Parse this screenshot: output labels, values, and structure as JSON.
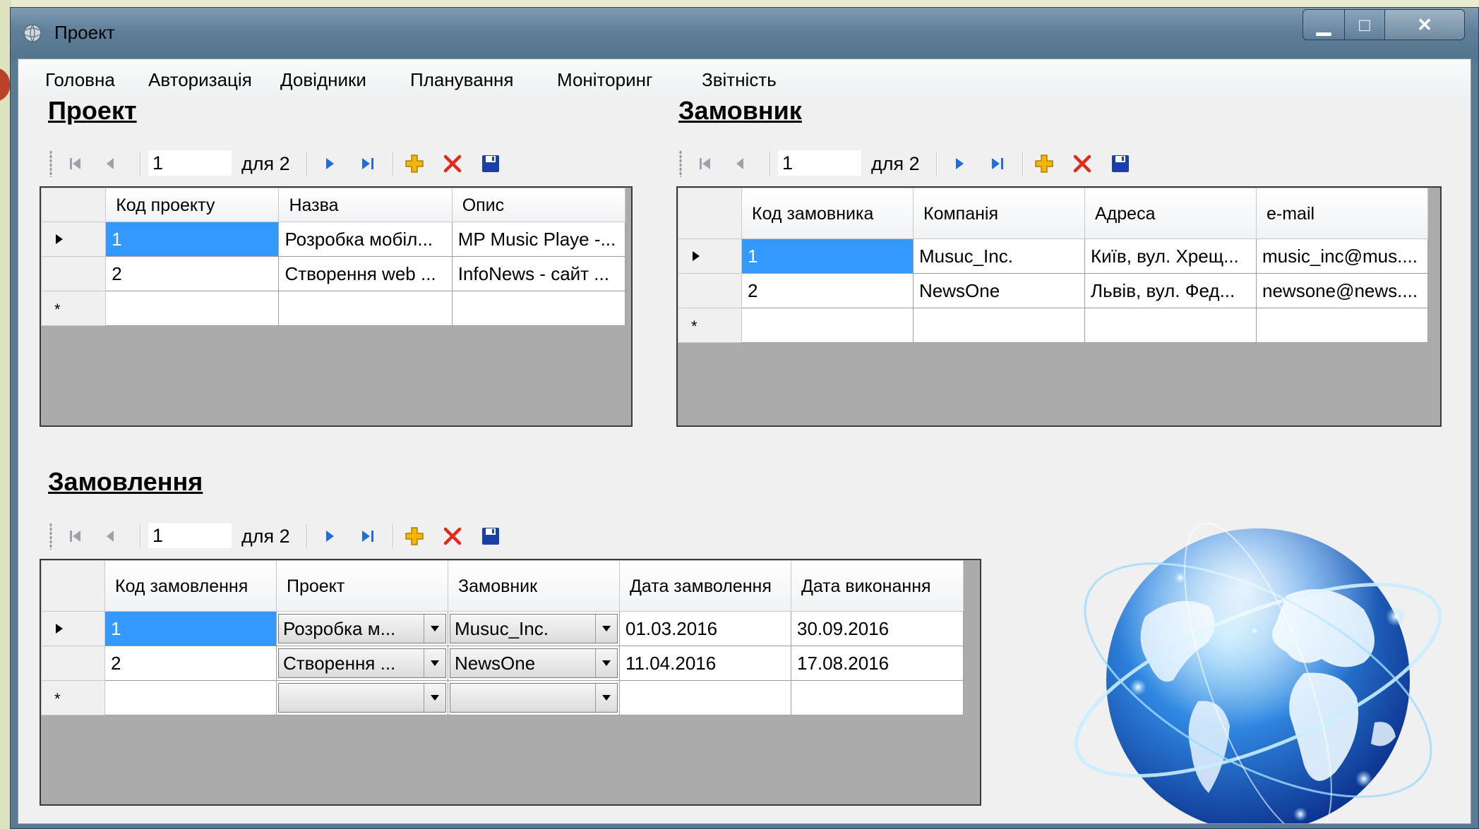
{
  "window": {
    "title": "Проект",
    "controls": {
      "minimize": "▁",
      "maximize": "□",
      "close": "✕"
    }
  },
  "menu": [
    "Головна",
    "Авторизація",
    "Довідники",
    "Планування",
    "Моніторинг",
    "Звітність"
  ],
  "navigator": {
    "position": "1",
    "count_label": "для 2"
  },
  "sections": {
    "project": {
      "title": "Проект",
      "columns": [
        "Код проекту",
        "Назва",
        "Опис"
      ],
      "rows": [
        [
          "1",
          "Розробка мобіл...",
          "MP Music Playe -..."
        ],
        [
          "2",
          "Створення web ...",
          "InfoNews -  сайт ..."
        ]
      ]
    },
    "customer": {
      "title": "Замовник",
      "columns": [
        "Код замовника",
        "Компанія",
        "Адреса",
        "e-mail"
      ],
      "rows": [
        [
          "1",
          "Musuc_Inc.",
          "Київ, вул. Хрещ...",
          "music_inc@mus...."
        ],
        [
          "2",
          "NewsOne",
          "Львів, вул. Фед...",
          "newsone@news...."
        ]
      ]
    },
    "order": {
      "title": "Замовлення",
      "columns": [
        "Код замовлення",
        "Проект",
        "Замовник",
        "Дата замволення",
        "Дата виконання"
      ],
      "rows": [
        [
          "1",
          "Розробка м...",
          "Musuc_Inc.",
          "01.03.2016",
          "30.09.2016"
        ],
        [
          "2",
          "Створення ...",
          "NewsOne",
          "11.04.2016",
          "17.08.2016"
        ]
      ]
    }
  },
  "new_row_marker": "*",
  "colors": {
    "selection": "#3399ff",
    "grid_background": "#ababab",
    "delete_icon": "#e02a1a",
    "add_icon": "#f2b705",
    "nav_icon": "#1e6fd9",
    "save_icon": "#1a3fa8"
  },
  "icons": [
    "app-globe-icon",
    "move-first-icon",
    "move-previous-icon",
    "move-next-icon",
    "move-last-icon",
    "add-new-icon",
    "delete-icon",
    "save-icon",
    "current-row-arrow-icon",
    "dropdown-arrow-icon",
    "globe-illustration"
  ]
}
